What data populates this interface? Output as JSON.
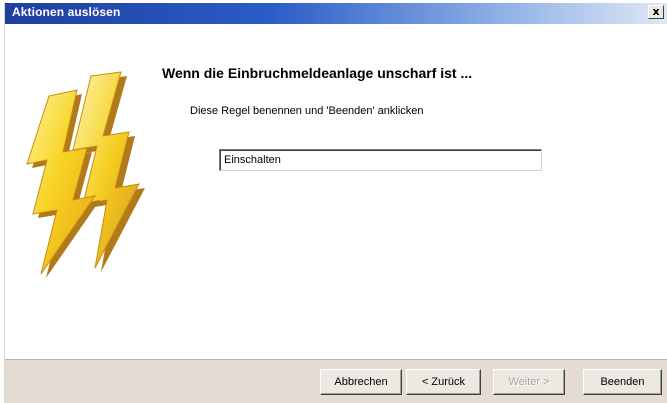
{
  "window": {
    "title": "Aktionen auslösen",
    "close_label": "x"
  },
  "main": {
    "heading": "Wenn die Einbruchmeldeanlage unscharf ist ...",
    "instruction": "Diese Regel benennen und 'Beenden' anklicken",
    "rule_name_value": "Einschalten",
    "illustration_icon": "lightning-bolts-icon"
  },
  "footer": {
    "cancel_label": "Abbrechen",
    "back_label": "< Zurück",
    "next_label": "Weiter >",
    "finish_label": "Beenden",
    "next_enabled": false
  },
  "colors": {
    "titlebar_start": "#1f3fa0",
    "titlebar_end": "#dfe8f6",
    "bolt_yellow": "#f7d323",
    "bolt_shadow": "#b07a1a",
    "footer_bg": "#e4dcd2"
  }
}
